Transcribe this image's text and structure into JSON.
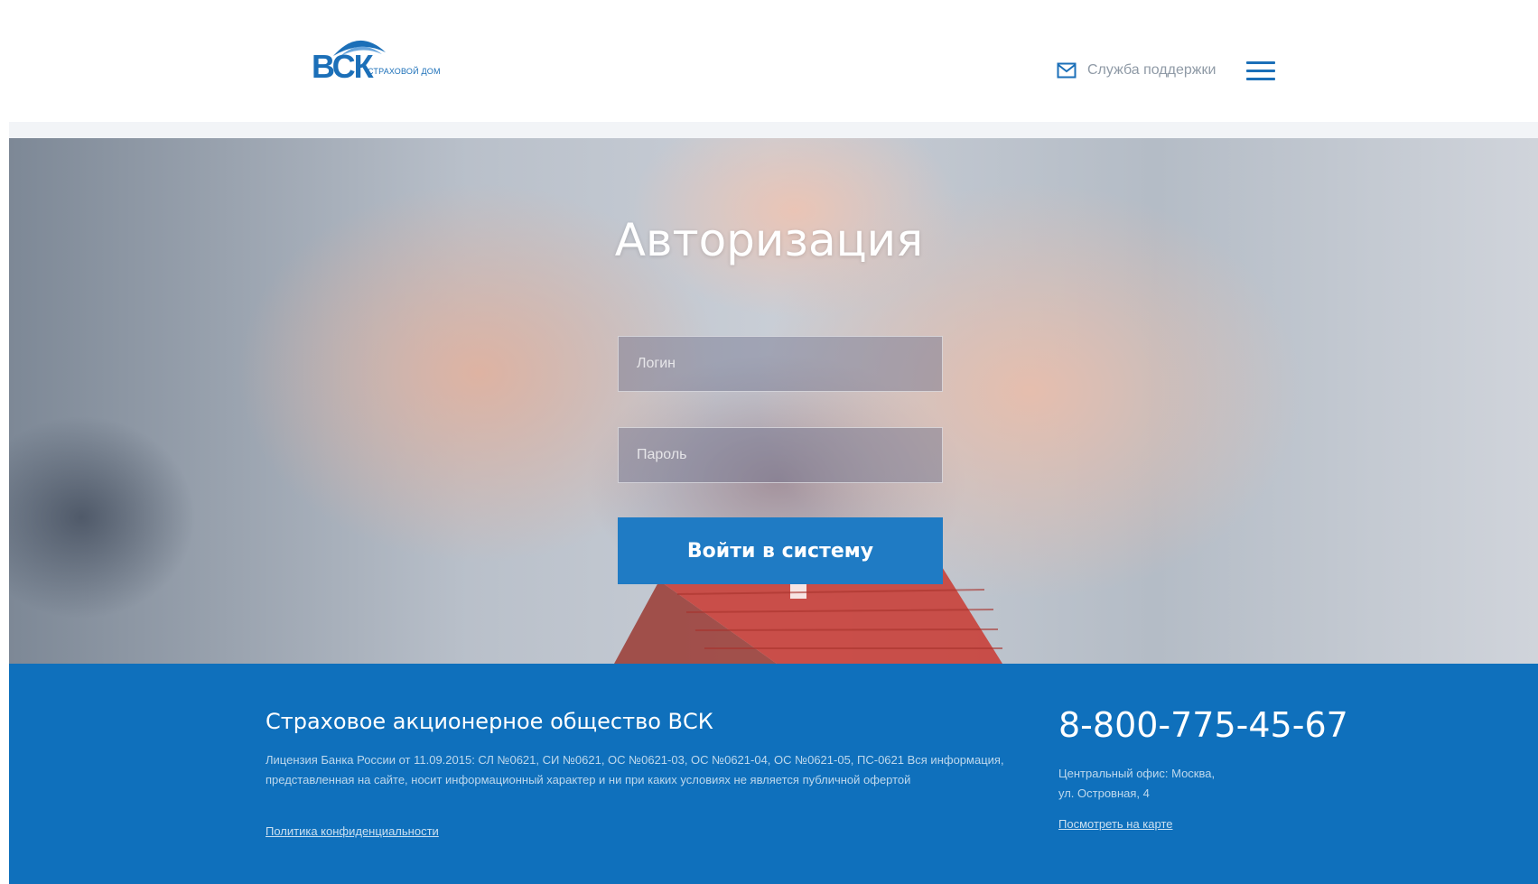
{
  "header": {
    "logo": {
      "mark": "ВСК",
      "subtitle": "страховой дом"
    },
    "support": {
      "label": "Служба поддержки",
      "icon": "envelope-icon"
    },
    "menu_icon": "hamburger-icon"
  },
  "login": {
    "title": "Авторизация",
    "login_placeholder": "Логин",
    "password_placeholder": "Пароль",
    "submit_label": "Войти в систему"
  },
  "footer": {
    "company_name": "Страховое акционерное общество ВСК",
    "license_text": "Лицензия Банка России от 11.09.2015: СЛ №0621, СИ №0621, ОС №0621-03, ОС №0621-04, ОС №0621-05, ПС-0621 Вся информация, представленная на сайте, носит информационный характер и ни при каких условиях не является публичной офертой",
    "privacy_link": "Политика конфиденциальности",
    "phone": "8-800-775-45-67",
    "office_label": "Центральный офис: Москва,",
    "office_address": "ул. Островная, 4",
    "map_link": "Посмотреть на карте"
  },
  "colors": {
    "brand_blue": "#1b6fb8",
    "button_blue": "#1f7bc4",
    "footer_blue": "#0f70bc"
  }
}
